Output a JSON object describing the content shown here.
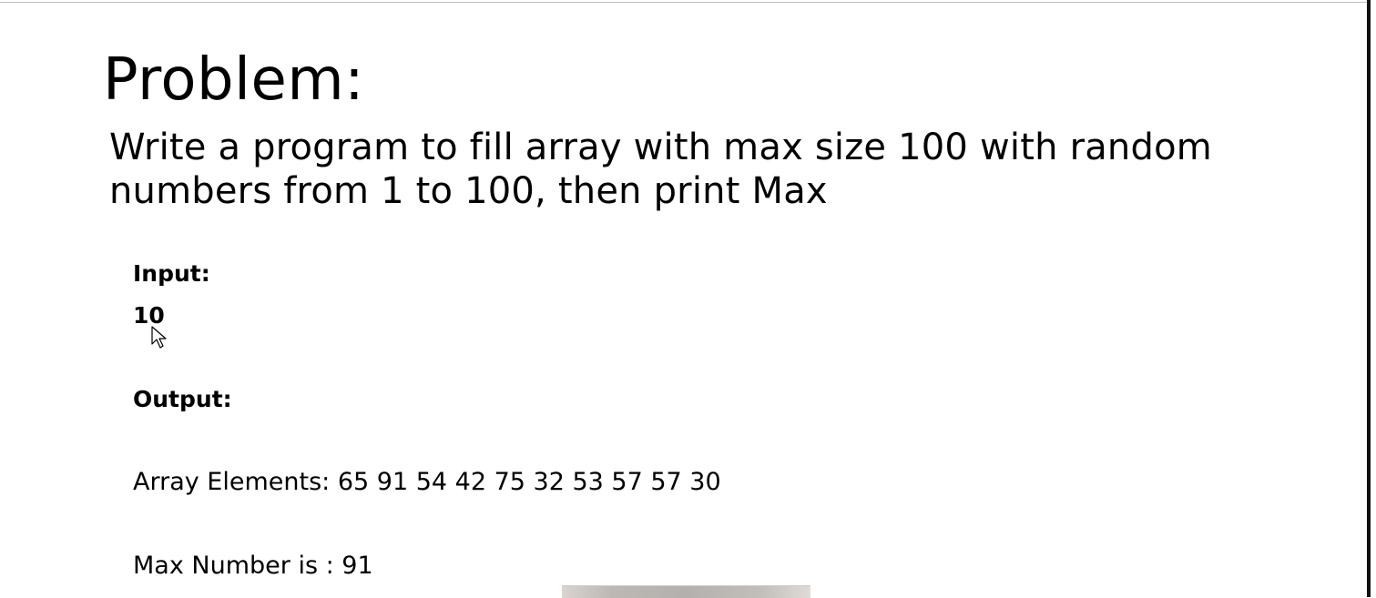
{
  "slide": {
    "title": "Problem:",
    "description": "Write a program to fill array with max size 100 with random numbers from 1 to 100, then print Max",
    "input": {
      "label": "Input:",
      "value": "10"
    },
    "output": {
      "label": "Output:",
      "array_line": "Array Elements: 65 91 54 42 75 32 53 57 57 30",
      "max_line": "Max Number is : 91"
    }
  },
  "icons": {
    "cursor": "mouse-pointer-icon"
  }
}
